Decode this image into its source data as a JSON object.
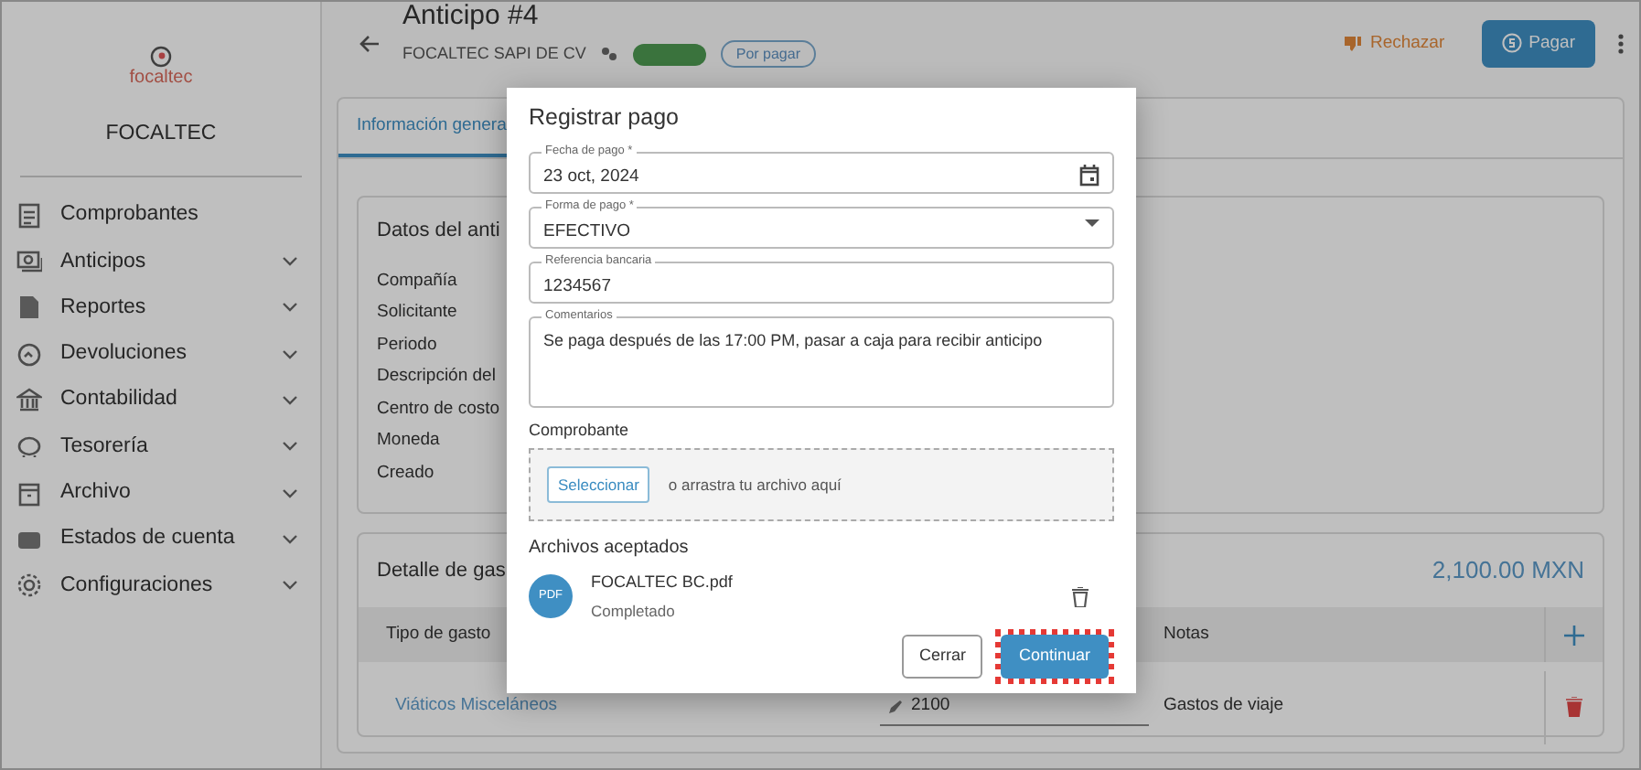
{
  "sidebar": {
    "brand": "focaltec",
    "company": "FOCALTEC",
    "items": [
      {
        "label": "Comprobantes",
        "expandable": false
      },
      {
        "label": "Anticipos",
        "expandable": true
      },
      {
        "label": "Reportes",
        "expandable": true
      },
      {
        "label": "Devoluciones",
        "expandable": true
      },
      {
        "label": "Contabilidad",
        "expandable": true
      },
      {
        "label": "Tesorería",
        "expandable": true
      },
      {
        "label": "Archivo",
        "expandable": true
      },
      {
        "label": "Estados de cuenta",
        "expandable": true
      },
      {
        "label": "Configuraciones",
        "expandable": true
      }
    ]
  },
  "header": {
    "title": "Anticipo #4",
    "subtitle": "FOCALTEC SAPI DE CV",
    "badges": [
      {
        "kind": "solid"
      },
      {
        "kind": "outline",
        "label": "Por pagar"
      }
    ],
    "actions": [
      {
        "kind": "text",
        "label": "Rechazar"
      },
      {
        "kind": "primary",
        "label": "Pagar"
      }
    ]
  },
  "tabs": [
    {
      "label": "Información genera",
      "selected": true
    }
  ],
  "details": {
    "title": "Datos del anti",
    "fields": [
      "Compañía",
      "Solicitante",
      "Periodo",
      "Descripción del",
      "Centro de costo",
      "Moneda",
      "Creado"
    ]
  },
  "expenses": {
    "title": "Detalle de gas",
    "total": "2,100.00 MXN",
    "columns": [
      "Tipo de gasto",
      "Notas"
    ],
    "rows": [
      {
        "type": "Viáticos Misceláneos",
        "amount": "2100",
        "notes": "Gastos de viaje"
      }
    ]
  },
  "dialog": {
    "title": "Registrar pago",
    "fields": [
      {
        "kind": "date",
        "label": "Fecha de pago *",
        "value": "23 oct, 2024"
      },
      {
        "kind": "select",
        "label": "Forma de pago *",
        "value": "EFECTIVO"
      },
      {
        "kind": "text",
        "label": "Referencia bancaria",
        "value": "1234567"
      },
      {
        "kind": "textarea",
        "label": "Comentarios",
        "value": "Se paga después de las 17:00 PM, pasar a caja para recibir anticipo"
      }
    ],
    "upload": {
      "label": "Comprobante",
      "button": "Seleccionar",
      "hint": "o arrastra tu archivo aquí"
    },
    "files_title": "Archivos aceptados",
    "files": [
      {
        "badge": "PDF",
        "name": "FOCALTEC BC.pdf",
        "status": "Completado"
      }
    ],
    "buttons": [
      {
        "kind": "secondary",
        "label": "Cerrar",
        "highlighted": false
      },
      {
        "kind": "primary",
        "label": "Continuar",
        "highlighted": true
      }
    ]
  }
}
